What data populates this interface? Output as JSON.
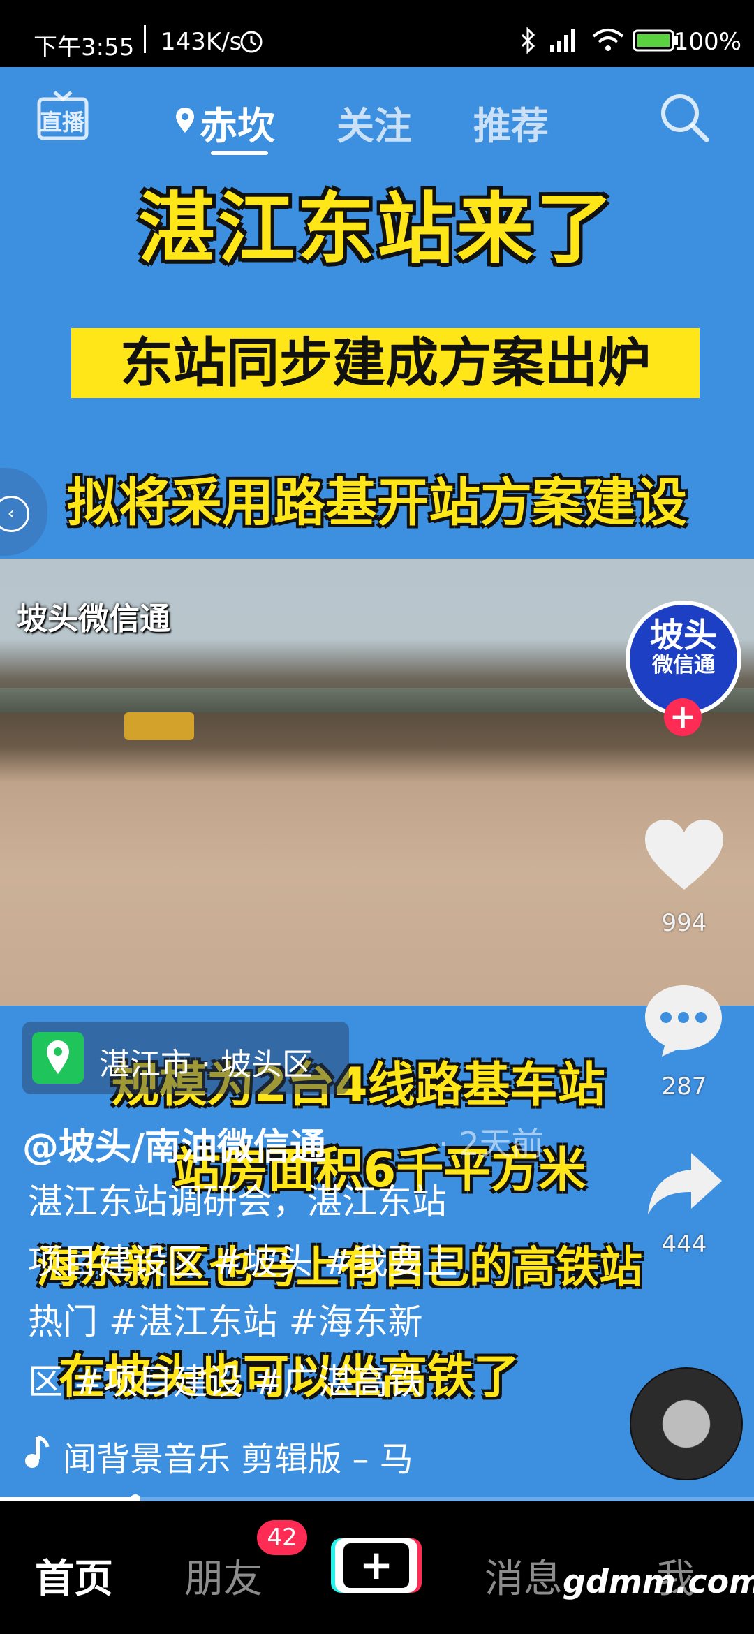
{
  "status_bar": {
    "time": "下午3:55",
    "speed": "143K/s",
    "battery": "100%"
  },
  "nav": {
    "live": "直播",
    "location": "赤坎",
    "follow": "关注",
    "recommend": "推荐"
  },
  "overlay": {
    "title": "湛江东站来了",
    "subtitle": "东站同步建成方案出炉",
    "line3": "拟将采用路基开站方案建设",
    "line4": "规模为2台4线路基车站",
    "line5": "站房面积6千平方米",
    "line6": "海东新区也马上有自己的高铁站",
    "line7": "在坡头也可以坐高铁了",
    "watermark": "坡头微信通"
  },
  "author": {
    "avatar_line1": "坡头",
    "avatar_line2": "微信通",
    "username": "@坡头/南油微信通",
    "time_ago": "· 2天前"
  },
  "location": {
    "text": "湛江市 · 坡头区"
  },
  "stats": {
    "likes": "994",
    "comments": "287",
    "shares": "444"
  },
  "description": {
    "line1": "湛江东站调研会，湛江东站",
    "line2": "项目建设区 #坡头 #我要上",
    "line3": "热门 #湛江东站 #海东新",
    "line4": "区 #项目建设 #广湛高铁"
  },
  "music": {
    "text": "闻背景音乐  剪辑版 – 马"
  },
  "playback": {
    "progress": 0.18
  },
  "bottom_nav": {
    "home": "首页",
    "friends": "朋友",
    "friends_badge": "42",
    "create": "+",
    "messages": "消息",
    "me": "我"
  },
  "site_watermark": "gdmm.com",
  "colors": {
    "accent_red": "#fe2c55",
    "video_blue": "#3d8fe0",
    "overlay_yellow": "#ffe619"
  }
}
